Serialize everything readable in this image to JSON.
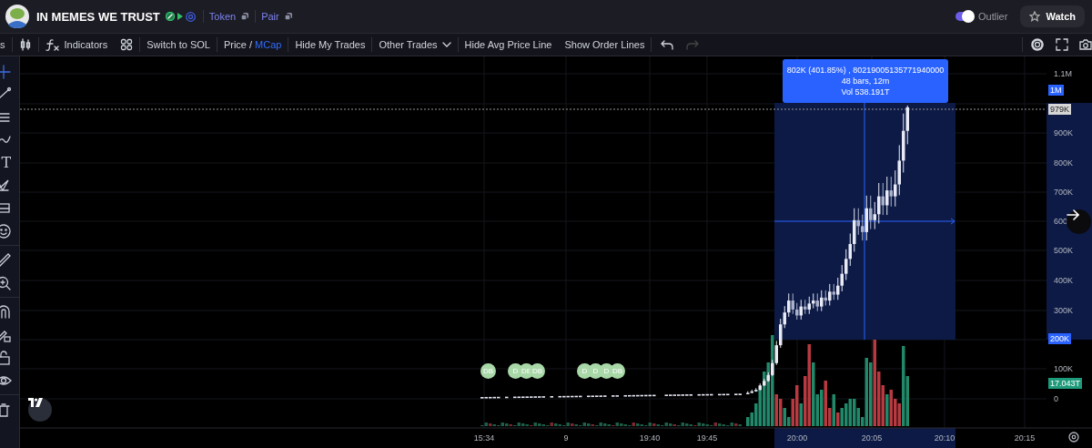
{
  "header": {
    "title": "IN MEMES WE TRUST",
    "links": [
      {
        "label": "Token"
      },
      {
        "label": "Pair"
      }
    ],
    "outlier_toggle": {
      "label": "Outlier",
      "on": true
    },
    "watch_button": {
      "label": "Watch"
    }
  },
  "toolbar": {
    "interval": "s",
    "indicators": "Indicators",
    "switch": "Switch to SOL",
    "price_mcap": {
      "separator": "/",
      "options": [
        {
          "label": "Price",
          "selected": false
        },
        {
          "label": "MCap",
          "selected": true
        }
      ]
    },
    "hide_my_trades": "Hide My Trades",
    "other_trades": "Other Trades",
    "hide_avg": "Hide Avg Price Line",
    "show_order_lines": "Show Order Lines",
    "undo": {
      "disabled": false
    },
    "redo": {
      "disabled": true
    }
  },
  "left_tools": {
    "text_tool": "T"
  },
  "chart": {
    "price_labels": [
      "1.1M",
      "900K",
      "800K",
      "700K",
      "600",
      "500K",
      "400K",
      "300K",
      "100K",
      "0"
    ],
    "price_tags": [
      {
        "label": "1M",
        "kind": "measure"
      },
      {
        "label": "979K",
        "kind": "last"
      },
      {
        "label": "200K",
        "kind": "measure"
      },
      {
        "label": "17.043T",
        "kind": "volume"
      }
    ],
    "measure": {
      "lines": [
        "802K (401.85%) , 80219005135771940000",
        "48 bars, 12m",
        "Vol 538.191T"
      ]
    },
    "trade_markers": [
      {
        "label": "DB"
      },
      {
        "label": "D"
      },
      {
        "label": "DE"
      },
      {
        "label": "DB"
      },
      {
        "label": "D"
      },
      {
        "label": "D"
      },
      {
        "label": "D"
      },
      {
        "label": "DB"
      }
    ],
    "time_labels": [
      "15:34",
      "9",
      "19:40",
      "19:45",
      "20:00",
      "20:05",
      "20:10",
      "20:15"
    ]
  }
}
